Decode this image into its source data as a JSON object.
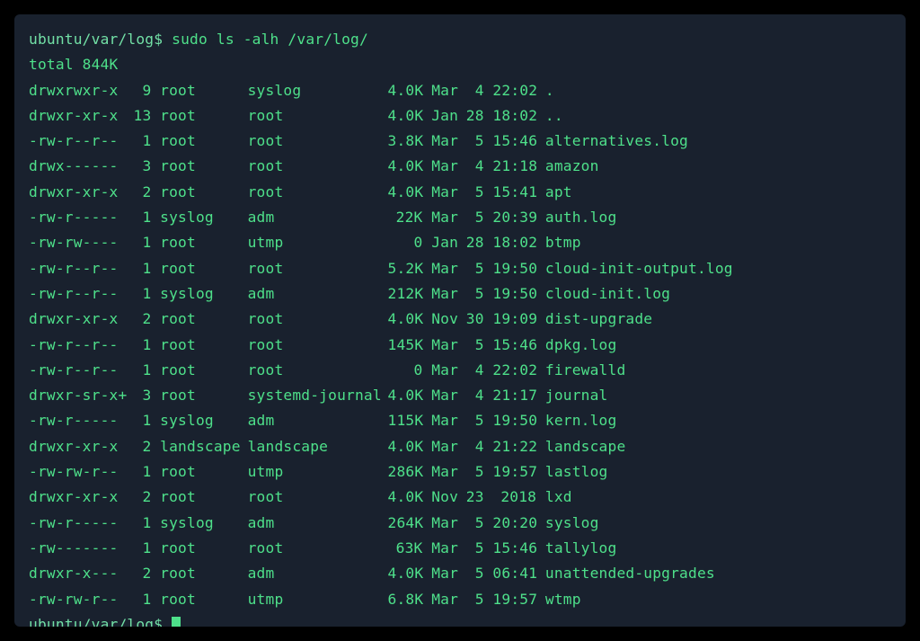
{
  "prompt": {
    "path": "ubuntu/var/log$",
    "cmd": "sudo ls -alh /var/log/"
  },
  "total_line": "total 844K",
  "rows": [
    {
      "perm": "drwxrwxr-x",
      "links": "9",
      "owner": "root",
      "group": "syslog",
      "size": "4.0K",
      "month": "Mar",
      "day": "4",
      "time": "22:02",
      "name": "."
    },
    {
      "perm": "drwxr-xr-x",
      "links": "13",
      "owner": "root",
      "group": "root",
      "size": "4.0K",
      "month": "Jan",
      "day": "28",
      "time": "18:02",
      "name": ".."
    },
    {
      "perm": "-rw-r--r--",
      "links": "1",
      "owner": "root",
      "group": "root",
      "size": "3.8K",
      "month": "Mar",
      "day": "5",
      "time": "15:46",
      "name": "alternatives.log"
    },
    {
      "perm": "drwx------",
      "links": "3",
      "owner": "root",
      "group": "root",
      "size": "4.0K",
      "month": "Mar",
      "day": "4",
      "time": "21:18",
      "name": "amazon"
    },
    {
      "perm": "drwxr-xr-x",
      "links": "2",
      "owner": "root",
      "group": "root",
      "size": "4.0K",
      "month": "Mar",
      "day": "5",
      "time": "15:41",
      "name": "apt"
    },
    {
      "perm": "-rw-r-----",
      "links": "1",
      "owner": "syslog",
      "group": "adm",
      "size": "22K",
      "month": "Mar",
      "day": "5",
      "time": "20:39",
      "name": "auth.log"
    },
    {
      "perm": "-rw-rw----",
      "links": "1",
      "owner": "root",
      "group": "utmp",
      "size": "0",
      "month": "Jan",
      "day": "28",
      "time": "18:02",
      "name": "btmp"
    },
    {
      "perm": "-rw-r--r--",
      "links": "1",
      "owner": "root",
      "group": "root",
      "size": "5.2K",
      "month": "Mar",
      "day": "5",
      "time": "19:50",
      "name": "cloud-init-output.log"
    },
    {
      "perm": "-rw-r--r--",
      "links": "1",
      "owner": "syslog",
      "group": "adm",
      "size": "212K",
      "month": "Mar",
      "day": "5",
      "time": "19:50",
      "name": "cloud-init.log"
    },
    {
      "perm": "drwxr-xr-x",
      "links": "2",
      "owner": "root",
      "group": "root",
      "size": "4.0K",
      "month": "Nov",
      "day": "30",
      "time": "19:09",
      "name": "dist-upgrade"
    },
    {
      "perm": "-rw-r--r--",
      "links": "1",
      "owner": "root",
      "group": "root",
      "size": "145K",
      "month": "Mar",
      "day": "5",
      "time": "15:46",
      "name": "dpkg.log"
    },
    {
      "perm": "-rw-r--r--",
      "links": "1",
      "owner": "root",
      "group": "root",
      "size": "0",
      "month": "Mar",
      "day": "4",
      "time": "22:02",
      "name": "firewalld"
    },
    {
      "perm": "drwxr-sr-x+",
      "links": "3",
      "owner": "root",
      "group": "systemd-journal",
      "size": "4.0K",
      "month": "Mar",
      "day": "4",
      "time": "21:17",
      "name": "journal"
    },
    {
      "perm": "-rw-r-----",
      "links": "1",
      "owner": "syslog",
      "group": "adm",
      "size": "115K",
      "month": "Mar",
      "day": "5",
      "time": "19:50",
      "name": "kern.log"
    },
    {
      "perm": "drwxr-xr-x",
      "links": "2",
      "owner": "landscape",
      "group": "landscape",
      "size": "4.0K",
      "month": "Mar",
      "day": "4",
      "time": "21:22",
      "name": "landscape"
    },
    {
      "perm": "-rw-rw-r--",
      "links": "1",
      "owner": "root",
      "group": "utmp",
      "size": "286K",
      "month": "Mar",
      "day": "5",
      "time": "19:57",
      "name": "lastlog"
    },
    {
      "perm": "drwxr-xr-x",
      "links": "2",
      "owner": "root",
      "group": "root",
      "size": "4.0K",
      "month": "Nov",
      "day": "23",
      "time": "2018",
      "name": "lxd"
    },
    {
      "perm": "-rw-r-----",
      "links": "1",
      "owner": "syslog",
      "group": "adm",
      "size": "264K",
      "month": "Mar",
      "day": "5",
      "time": "20:20",
      "name": "syslog"
    },
    {
      "perm": "-rw-------",
      "links": "1",
      "owner": "root",
      "group": "root",
      "size": "63K",
      "month": "Mar",
      "day": "5",
      "time": "15:46",
      "name": "tallylog"
    },
    {
      "perm": "drwxr-x---",
      "links": "2",
      "owner": "root",
      "group": "adm",
      "size": "4.0K",
      "month": "Mar",
      "day": "5",
      "time": "06:41",
      "name": "unattended-upgrades"
    },
    {
      "perm": "-rw-rw-r--",
      "links": "1",
      "owner": "root",
      "group": "utmp",
      "size": "6.8K",
      "month": "Mar",
      "day": "5",
      "time": "19:57",
      "name": "wtmp"
    }
  ],
  "prompt2": {
    "path": "ubuntu/var/log$"
  }
}
